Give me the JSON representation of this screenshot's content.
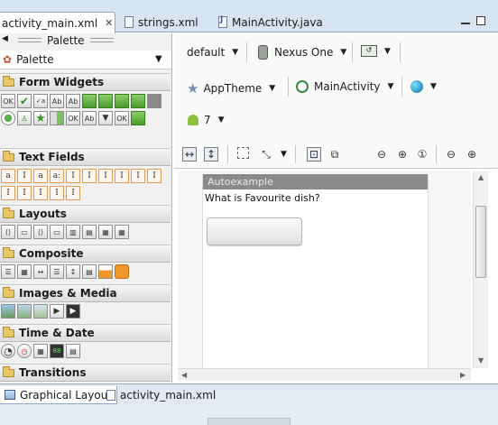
{
  "editor_tabs": [
    {
      "label": "activity_main.xml",
      "active": true,
      "closable": true
    },
    {
      "label": "strings.xml",
      "active": false
    },
    {
      "label": "MainActivity.java",
      "active": false
    }
  ],
  "palette": {
    "title": "Palette",
    "selector_value": "Palette",
    "categories": [
      {
        "label": "Form Widgets"
      },
      {
        "label": "Text Fields"
      },
      {
        "label": "Layouts"
      },
      {
        "label": "Composite"
      },
      {
        "label": "Images & Media"
      },
      {
        "label": "Time & Date"
      },
      {
        "label": "Transitions"
      }
    ],
    "form_widget_labels": [
      "Ab",
      "Ab",
      "Ab",
      "OK",
      "Ab"
    ],
    "text_field_glyphs": [
      "a",
      "I",
      "a",
      "a:",
      "I",
      "I",
      "I",
      "I",
      "I",
      "I",
      "I",
      "I",
      "I",
      "I",
      "I"
    ],
    "ok_labels": [
      "OK",
      "OK"
    ]
  },
  "config": {
    "theme_variant": "default",
    "device": "Nexus One",
    "app_theme": "AppTheme",
    "activity": "MainActivity",
    "api_level": "7"
  },
  "preview": {
    "app_title": "Autoexample",
    "question_text": "What is Favourite dish?",
    "button_text": ""
  },
  "bottom_tabs": [
    {
      "label": "Graphical Layout",
      "active": true
    },
    {
      "label": "activity_main.xml",
      "active": false
    }
  ],
  "colors": {
    "accent": "#8fa5c1",
    "app_bar": "#8a8a8a",
    "android_green": "#8fc23c"
  }
}
